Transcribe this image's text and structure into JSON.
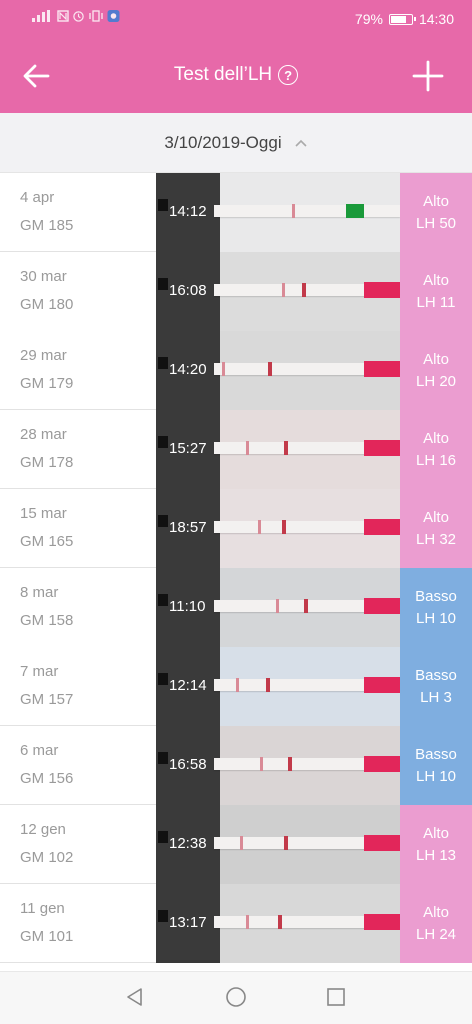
{
  "statusbar": {
    "battery_pct": "79%",
    "battery_level": 0.79,
    "time": "14:30",
    "icons": [
      "signal-icon",
      "nfc-icon",
      "alarm-icon",
      "vibrate-icon",
      "app-icon"
    ]
  },
  "appbar": {
    "title": "Test dell’LH",
    "help_glyph": "?",
    "back_icon": "arrow-left-icon",
    "add_icon": "plus-icon"
  },
  "date_filter": {
    "label": "3/10/2019-Oggi",
    "icon": "chevron-up-icon"
  },
  "colors": {
    "primary": "#e769a9",
    "alto": "#e88cc8",
    "basso": "#7faee0"
  },
  "tests": [
    {
      "date": "4 apr",
      "day": "GM 185",
      "time": "14:12",
      "level": "Alto",
      "lh": "LH 50"
    },
    {
      "date": "30 mar",
      "day": "GM 180",
      "time": "16:08",
      "level": "Alto",
      "lh": "LH 11"
    },
    {
      "date": "29 mar",
      "day": "GM 179",
      "time": "14:20",
      "level": "Alto",
      "lh": "LH 20"
    },
    {
      "date": "28 mar",
      "day": "GM 178",
      "time": "15:27",
      "level": "Alto",
      "lh": "LH 16"
    },
    {
      "date": "15 mar",
      "day": "GM 165",
      "time": "18:57",
      "level": "Alto",
      "lh": "LH 32"
    },
    {
      "date": "8 mar",
      "day": "GM 158",
      "time": "11:10",
      "level": "Basso",
      "lh": "LH 10"
    },
    {
      "date": "7 mar",
      "day": "GM 157",
      "time": "12:14",
      "level": "Basso",
      "lh": "LH 3"
    },
    {
      "date": "6 mar",
      "day": "GM 156",
      "time": "16:58",
      "level": "Basso",
      "lh": "LH 10"
    },
    {
      "date": "12 gen",
      "day": "GM 102",
      "time": "12:38",
      "level": "Alto",
      "lh": "LH 13"
    },
    {
      "date": "11 gen",
      "day": "GM 101",
      "time": "13:17",
      "level": "Alto",
      "lh": "LH 24"
    }
  ],
  "navbar": {
    "icons": [
      "nav-back-icon",
      "nav-home-icon",
      "nav-recent-icon"
    ]
  }
}
